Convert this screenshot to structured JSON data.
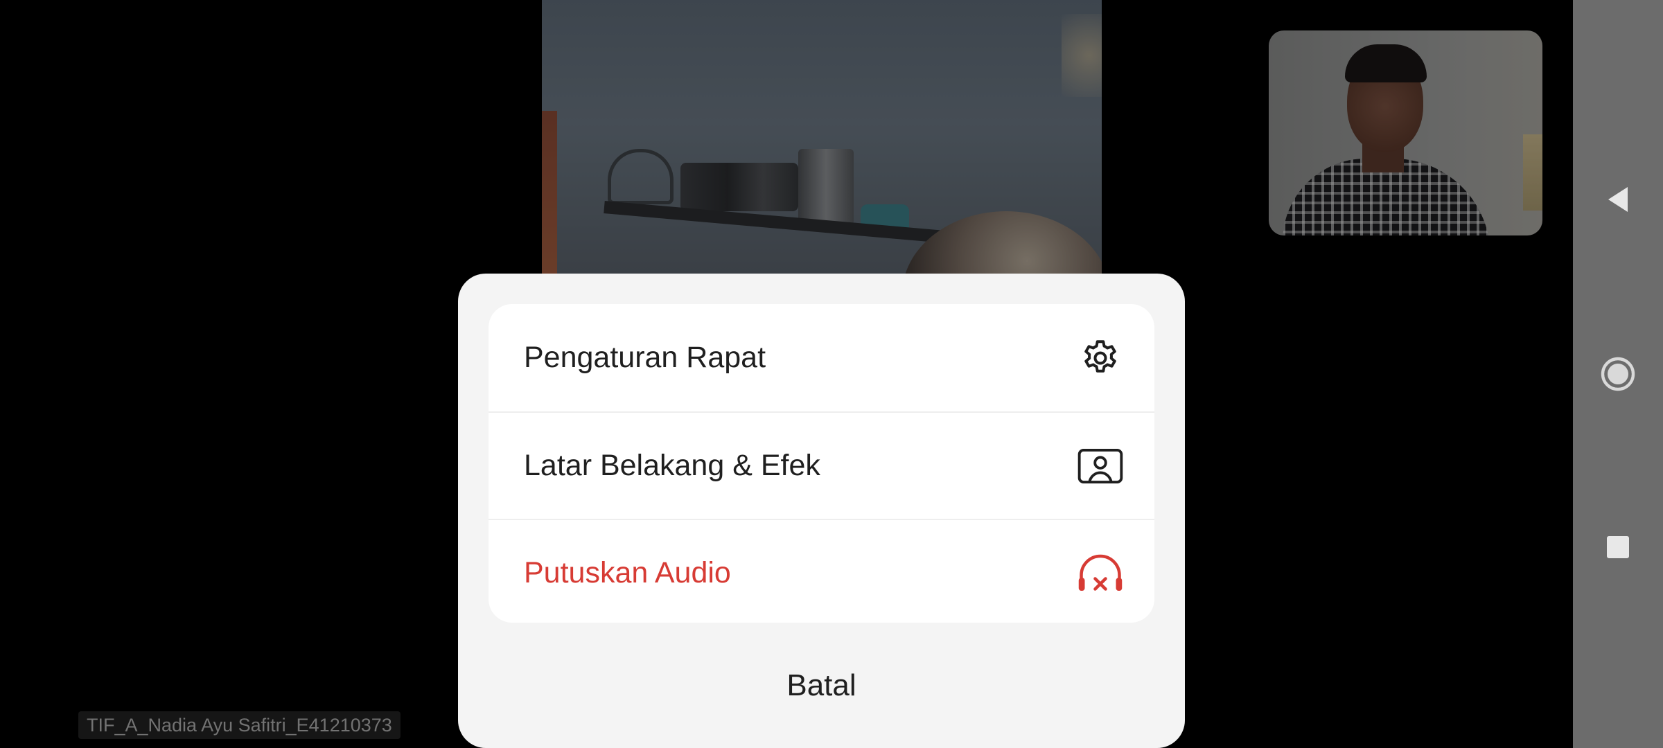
{
  "participants": {
    "remote_name": "TIF_A_Nadia Ayu Safitri_E41210373"
  },
  "menu": {
    "items": [
      {
        "label": "Pengaturan Rapat",
        "icon": "gear-icon"
      },
      {
        "label": "Latar Belakang & Efek",
        "icon": "background-portrait-icon"
      },
      {
        "label": "Putuskan Audio",
        "icon": "headphones-disconnect-icon",
        "color": "#d73b34"
      }
    ],
    "cancel_label": "Batal"
  },
  "navbar": {
    "buttons": [
      "back-icon",
      "home-icon",
      "recent-apps-icon"
    ]
  }
}
